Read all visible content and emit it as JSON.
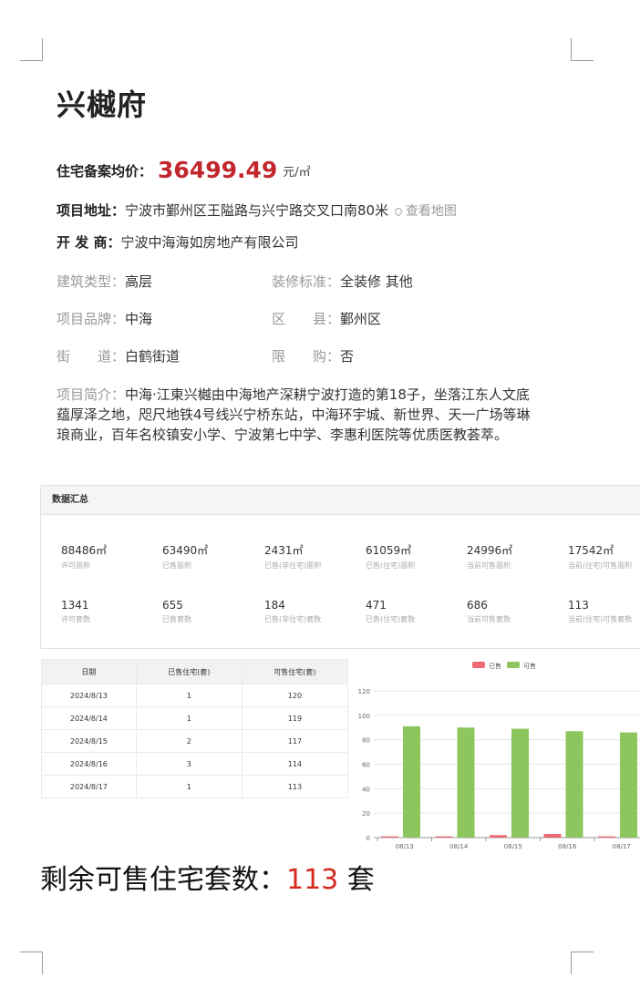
{
  "project": {
    "name": "兴樾府",
    "price_label": "住宅备案均价：",
    "price_value": "36499.49",
    "price_unit": "元/㎡",
    "address_label": "项目地址：",
    "address_value": "宁波市鄞州区王隘路与兴宁路交叉口南80米",
    "map_link": "查看地图",
    "developer_label": "开 发 商：",
    "developer_value": "宁波中海海如房地产有限公司"
  },
  "attributes": [
    {
      "label": "建筑类型：",
      "value": "高层"
    },
    {
      "label": "装修标准：",
      "value": "全装修 其他"
    },
    {
      "label": "项目品牌：",
      "value": "中海"
    },
    {
      "label": "区　　县：",
      "value": "鄞州区"
    },
    {
      "label": "街　　道：",
      "value": "白鹤街道"
    },
    {
      "label": "限　　购：",
      "value": "否"
    }
  ],
  "intro": {
    "label": "项目简介：",
    "text": "中海·江東兴樾由中海地产深耕宁波打造的第18子，坐落江东人文底蕴厚泽之地，咫尺地铁4号线兴宁桥东站，中海环宇城、新世界、天一广场等琳琅商业，百年名校镇安小学、宁波第七中学、李惠利医院等优质医教荟萃。"
  },
  "summary_panel": {
    "title": "数据汇总",
    "stats": [
      {
        "value": "88486㎡",
        "label": "许可面积"
      },
      {
        "value": "63490㎡",
        "label": "已售面积"
      },
      {
        "value": "2431㎡",
        "label": "已售(非住宅)面积"
      },
      {
        "value": "61059㎡",
        "label": "已售(住宅)面积"
      },
      {
        "value": "24996㎡",
        "label": "当前可售面积"
      },
      {
        "value": "17542㎡",
        "label": "当前(住宅)可售面积"
      },
      {
        "value": "1341",
        "label": "许可套数"
      },
      {
        "value": "655",
        "label": "已售套数"
      },
      {
        "value": "184",
        "label": "已售(非住宅)套数"
      },
      {
        "value": "471",
        "label": "已售(住宅)套数"
      },
      {
        "value": "686",
        "label": "当前可售套数"
      },
      {
        "value": "113",
        "label": "当前(住宅)可售套数"
      }
    ]
  },
  "table": {
    "headers": [
      "日期",
      "已售住宅(套)",
      "可售住宅(套)"
    ],
    "rows": [
      [
        "2024/8/13",
        "1",
        "120"
      ],
      [
        "2024/8/14",
        "1",
        "119"
      ],
      [
        "2024/8/15",
        "2",
        "117"
      ],
      [
        "2024/8/16",
        "3",
        "114"
      ],
      [
        "2024/8/17",
        "1",
        "113"
      ]
    ]
  },
  "colors": {
    "sold": "#ee6a73",
    "available": "#8cc65c",
    "price": "#c1272d",
    "summary_number": "#d42a1f"
  },
  "chart_data": {
    "type": "bar",
    "categories": [
      "08/13",
      "08/14",
      "08/15",
      "08/16",
      "08/17"
    ],
    "series": [
      {
        "name": "已售",
        "values": [
          1,
          1,
          2,
          3,
          1
        ]
      },
      {
        "name": "可售",
        "values": [
          91,
          90,
          89,
          87,
          86
        ]
      }
    ],
    "ylim": [
      0,
      120
    ],
    "yticks": [
      0,
      20,
      40,
      60,
      80,
      100,
      120
    ],
    "grid": true,
    "legend": "top"
  },
  "footer_summary": {
    "label": "剩余可售住宅套数：",
    "value": "113",
    "unit": " 套"
  }
}
